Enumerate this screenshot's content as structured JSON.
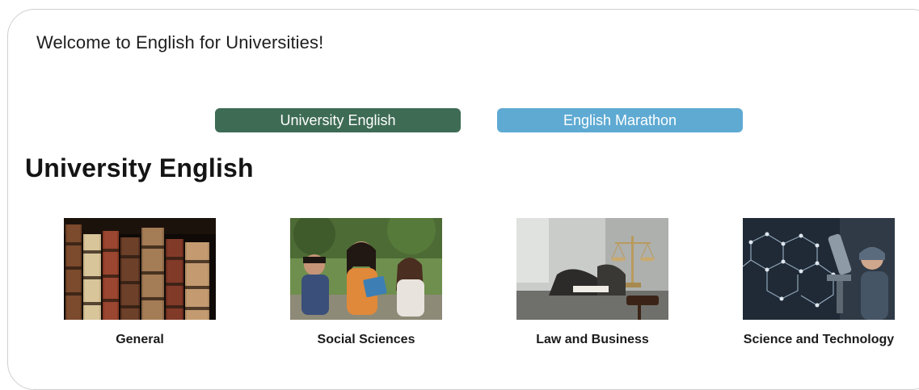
{
  "header": {
    "welcome_text": "Welcome to English for Universities!"
  },
  "tabs": [
    {
      "label": "University English",
      "color": "#3e6b54",
      "active": true
    },
    {
      "label": "English Marathon",
      "color": "#5eaad3",
      "active": false
    }
  ],
  "section": {
    "title": "University English"
  },
  "cards": [
    {
      "label": "General",
      "image": "old-books-image"
    },
    {
      "label": "Social Sciences",
      "image": "students-studying-image"
    },
    {
      "label": "Law and Business",
      "image": "scales-of-justice-image"
    },
    {
      "label": "Science and Technology",
      "image": "microscope-molecules-image"
    }
  ]
}
